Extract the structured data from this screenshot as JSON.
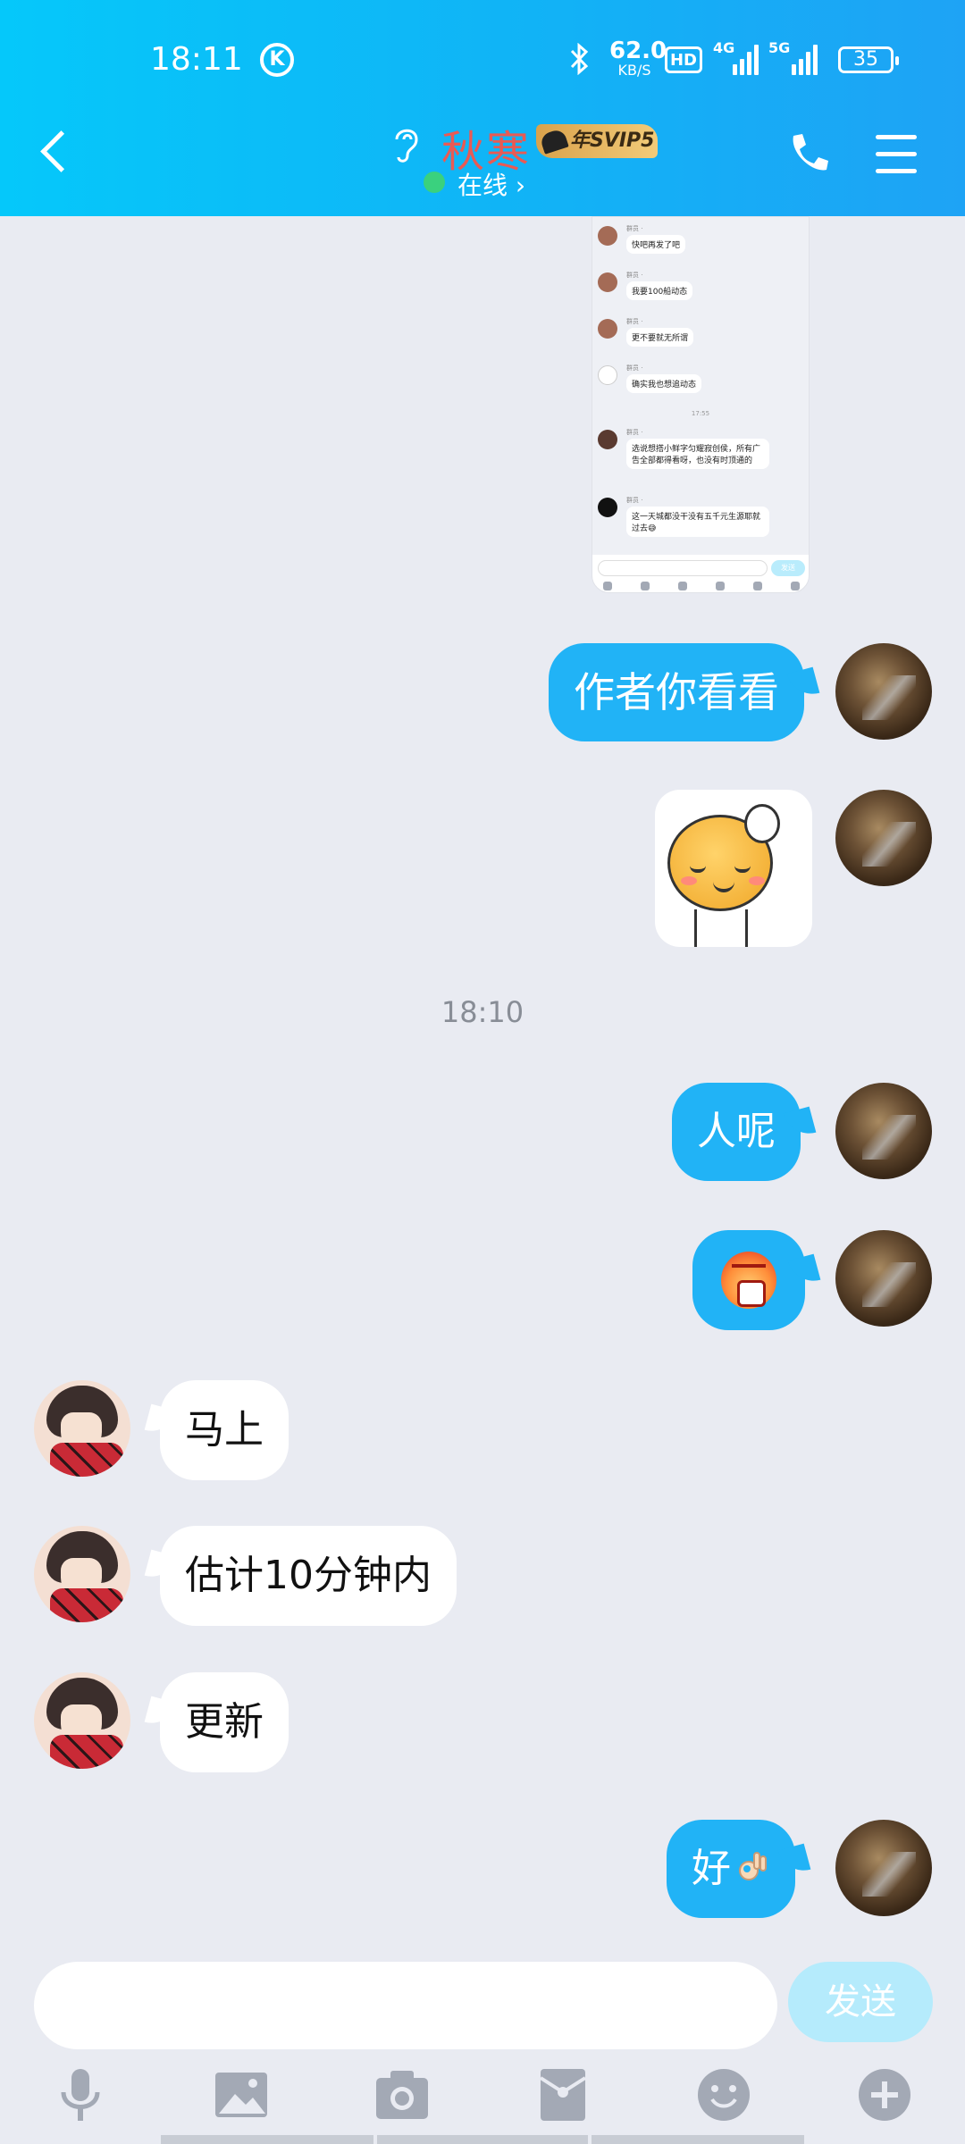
{
  "status_bar": {
    "time": "18:11",
    "k_badge": "K",
    "speed_value": "62.0",
    "speed_unit": "KB/S",
    "hd_badge": "HD",
    "net_1": "4G",
    "net_2": "5G",
    "battery": "35"
  },
  "header": {
    "contact_name": "秋寒",
    "vip_badge": "年SVIP5",
    "presence": "在线 ›",
    "icons": [
      "back-icon",
      "ear-icon",
      "phone-icon",
      "menu-icon"
    ]
  },
  "shared_screenshot": {
    "messages": [
      {
        "text": "快吧再发了吧"
      },
      {
        "text": "我要100船动态"
      },
      {
        "text": "更不要就无所谓"
      },
      {
        "text": "确实我也想追动态"
      },
      {
        "text": "选说想搭小鲜字匀耀寂创侯，所有广告全部都得看呀，也没有时顶通的"
      },
      {
        "text": "这一天城都没干没有五千元生源耶就过去😅"
      }
    ],
    "time": "17:55",
    "send_label": "发送"
  },
  "messages": [
    {
      "side": "out",
      "type": "text",
      "text": "作者你看看"
    },
    {
      "side": "out",
      "type": "sticker",
      "sticker": "smiling-face-scratching-head"
    },
    {
      "type": "timestamp",
      "text": "18:10"
    },
    {
      "side": "out",
      "type": "text",
      "text": "人呢"
    },
    {
      "side": "out",
      "type": "emoji",
      "emoji": "angry-face"
    },
    {
      "side": "in",
      "type": "text",
      "text": "马上"
    },
    {
      "side": "in",
      "type": "text",
      "text": "估计10分钟内"
    },
    {
      "side": "in",
      "type": "text",
      "text": "更新"
    },
    {
      "side": "out",
      "type": "text",
      "text": "好"
    }
  ],
  "input_bar": {
    "placeholder": "",
    "send_label": "发送",
    "tools": [
      "microphone-icon",
      "image-icon",
      "camera-icon",
      "red-packet-icon",
      "emoji-icon",
      "plus-icon"
    ]
  },
  "colors": {
    "header_start": "#05c8fa",
    "header_end": "#1ea3f5",
    "outgoing_bubble": "#21b3f6",
    "incoming_bubble": "#ffffff",
    "background": "#e9ebf2",
    "name_color": "#e95a54",
    "send_disabled": "#b5ebfc",
    "online_dot": "#3ad17e"
  }
}
